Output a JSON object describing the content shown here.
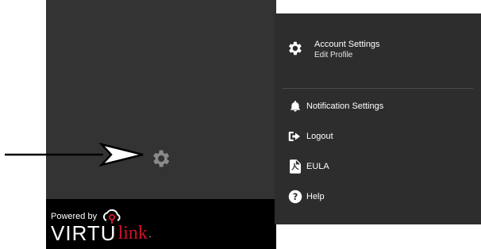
{
  "branding": {
    "powered_by": "Powered by",
    "brand_main": "VIRTU",
    "brand_accent": "link",
    "brand_tm": "-"
  },
  "menu": {
    "account": {
      "title": "Account Settings",
      "subtitle": "Edit Profile",
      "icon": "gear-icon"
    },
    "items": [
      {
        "label": "Notification Settings",
        "icon": "bell-icon"
      },
      {
        "label": "Logout",
        "icon": "logout-icon"
      },
      {
        "label": "EULA",
        "icon": "document-icon"
      },
      {
        "label": "Help",
        "icon": "help-icon"
      }
    ]
  },
  "colors": {
    "sidebar_bg": "#333333",
    "menu_bg": "#2d2d2d",
    "brand_bg": "#000000",
    "brand_accent": "#d0112b",
    "gear_gray": "#8a8a8a"
  }
}
